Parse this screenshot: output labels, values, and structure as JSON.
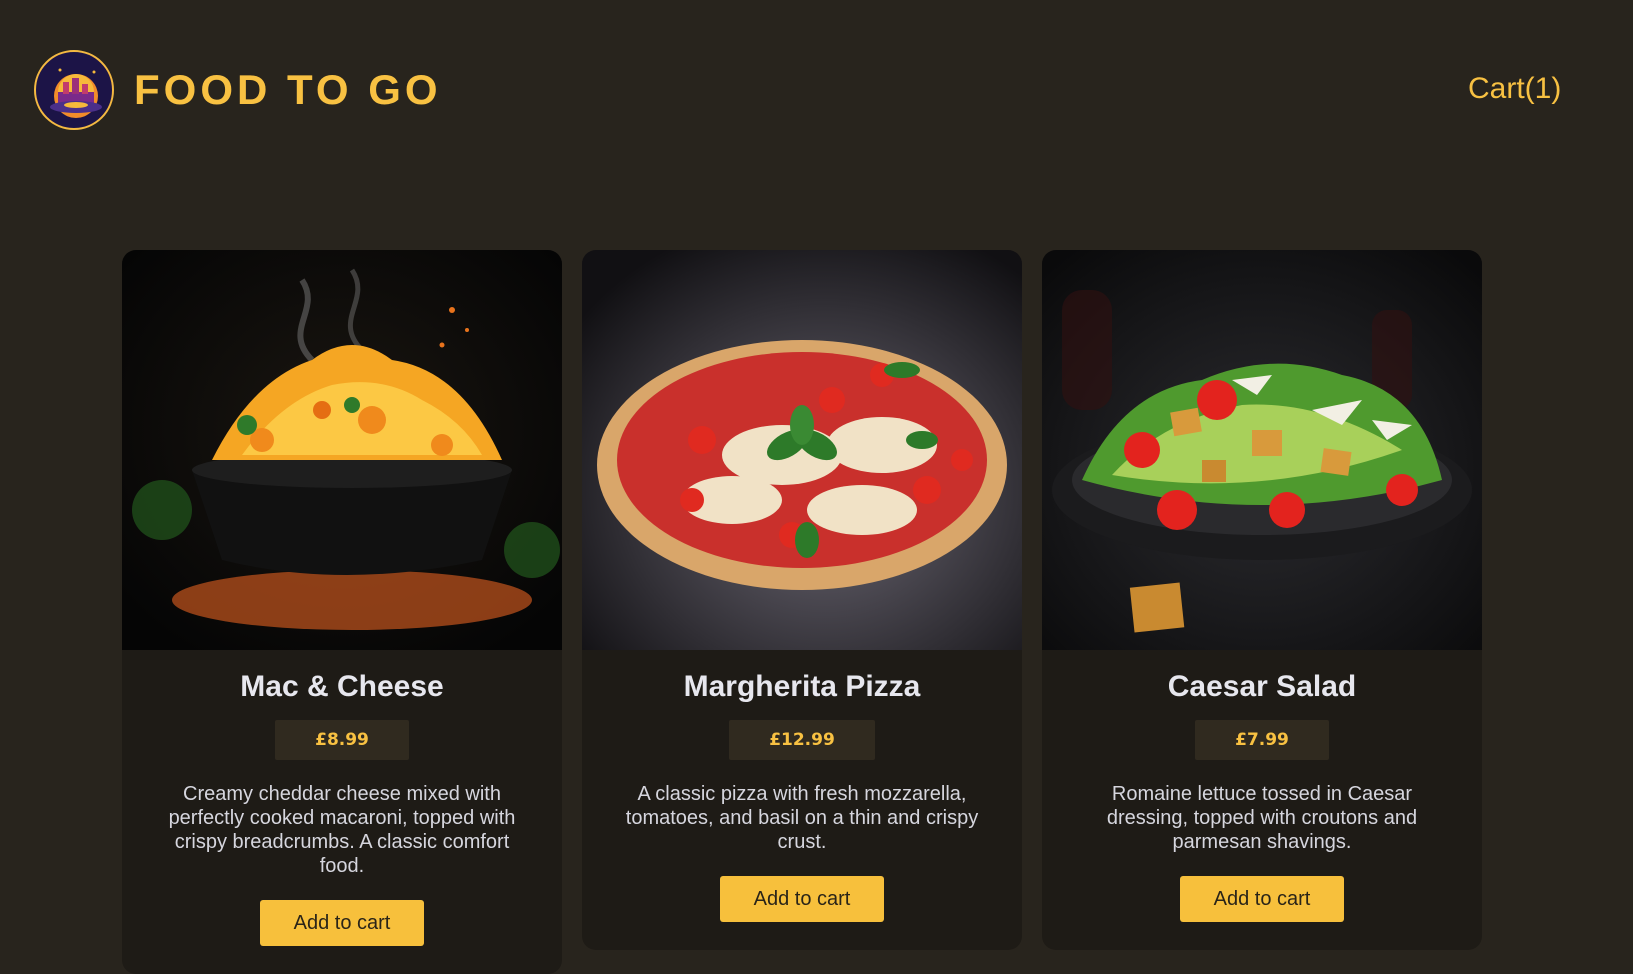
{
  "header": {
    "brand": "FOOD TO GO",
    "cart_label": "Cart(1)",
    "logo_icon": "restaurant-logo-icon"
  },
  "colors": {
    "background": "#28241d",
    "card": "#1e1b16",
    "accent": "#f8c142",
    "button": "#f7c03c"
  },
  "menu": {
    "items": [
      {
        "name": "Mac & Cheese",
        "price": "£8.99",
        "description": "Creamy cheddar cheese mixed with perfectly cooked macaroni, topped with crispy breadcrumbs. A classic comfort food.",
        "button_label": "Add to cart",
        "image_icon": "mac-and-cheese-photo"
      },
      {
        "name": "Margherita Pizza",
        "price": "£12.99",
        "description": "A classic pizza with fresh mozzarella, tomatoes, and basil on a thin and crispy crust.",
        "button_label": "Add to cart",
        "image_icon": "margherita-pizza-photo"
      },
      {
        "name": "Caesar Salad",
        "price": "£7.99",
        "description": "Romaine lettuce tossed in Caesar dressing, topped with croutons and parmesan shavings.",
        "button_label": "Add to cart",
        "image_icon": "caesar-salad-photo"
      }
    ]
  }
}
